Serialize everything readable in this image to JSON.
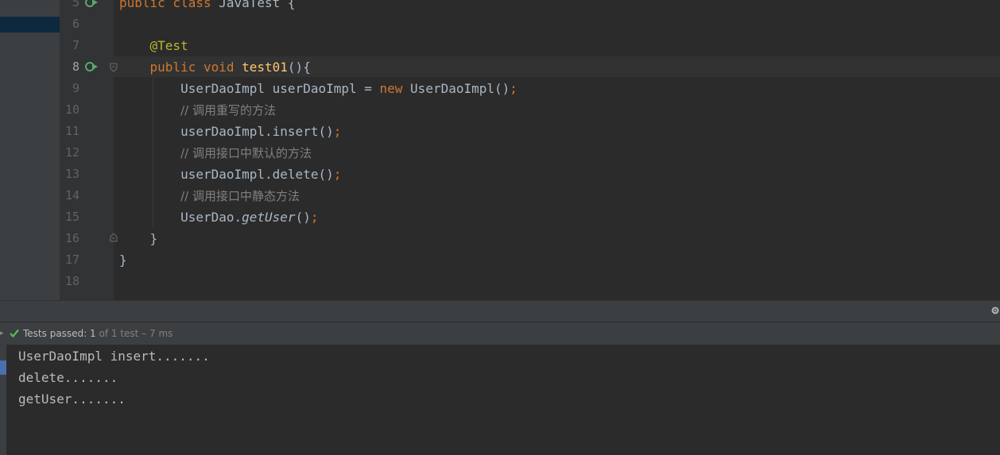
{
  "editor": {
    "lines": [
      {
        "num": "5",
        "tokens": [
          {
            "t": "public class ",
            "c": "kw"
          },
          {
            "t": "JavaTest {",
            "c": "plain"
          }
        ]
      },
      {
        "num": "6",
        "tokens": []
      },
      {
        "num": "7",
        "tokens": [
          {
            "t": "    ",
            "c": "plain"
          },
          {
            "t": "@Test",
            "c": "ann"
          }
        ]
      },
      {
        "num": "8",
        "tokens": [
          {
            "t": "    ",
            "c": "plain"
          },
          {
            "t": "public void ",
            "c": "kw"
          },
          {
            "t": "test01",
            "c": "fn"
          },
          {
            "t": "(){",
            "c": "plain"
          }
        ]
      },
      {
        "num": "9",
        "tokens": [
          {
            "t": "        UserDaoImpl userDaoImpl = ",
            "c": "plain"
          },
          {
            "t": "new ",
            "c": "kw"
          },
          {
            "t": "UserDaoImpl()",
            "c": "plain"
          },
          {
            "t": ";",
            "c": "kw"
          }
        ]
      },
      {
        "num": "10",
        "tokens": [
          {
            "t": "        ",
            "c": "plain"
          },
          {
            "t": "// 调用重写的方法",
            "c": "cm"
          }
        ]
      },
      {
        "num": "11",
        "tokens": [
          {
            "t": "        userDaoImpl.insert()",
            "c": "plain"
          },
          {
            "t": ";",
            "c": "kw"
          }
        ]
      },
      {
        "num": "12",
        "tokens": [
          {
            "t": "        ",
            "c": "plain"
          },
          {
            "t": "// 调用接口中默认的方法",
            "c": "cm"
          }
        ]
      },
      {
        "num": "13",
        "tokens": [
          {
            "t": "        userDaoImpl.delete()",
            "c": "plain"
          },
          {
            "t": ";",
            "c": "kw"
          }
        ]
      },
      {
        "num": "14",
        "tokens": [
          {
            "t": "        ",
            "c": "plain"
          },
          {
            "t": "// 调用接口中静态方法",
            "c": "cm"
          }
        ]
      },
      {
        "num": "15",
        "tokens": [
          {
            "t": "        UserDao.",
            "c": "plain"
          },
          {
            "t": "getUser",
            "c": "it"
          },
          {
            "t": "()",
            "c": "plain"
          },
          {
            "t": ";",
            "c": "kw"
          }
        ]
      },
      {
        "num": "16",
        "tokens": [
          {
            "t": "    }",
            "c": "plain"
          }
        ]
      },
      {
        "num": "17",
        "tokens": [
          {
            "t": "}",
            "c": "plain"
          }
        ]
      },
      {
        "num": "18",
        "tokens": []
      }
    ]
  },
  "run": {
    "status_prefix": "Tests passed: ",
    "status_count": "1",
    "status_suffix": " of 1 test – 7 ms",
    "output": [
      "UserDaoImpl insert.......",
      "delete.......",
      "getUser......."
    ]
  },
  "colors": {
    "keyword": "#cc7832",
    "annotation": "#bbb529",
    "function": "#ffc66d",
    "comment": "#808080",
    "text": "#a9b7c6",
    "pass": "#5fb85f"
  }
}
